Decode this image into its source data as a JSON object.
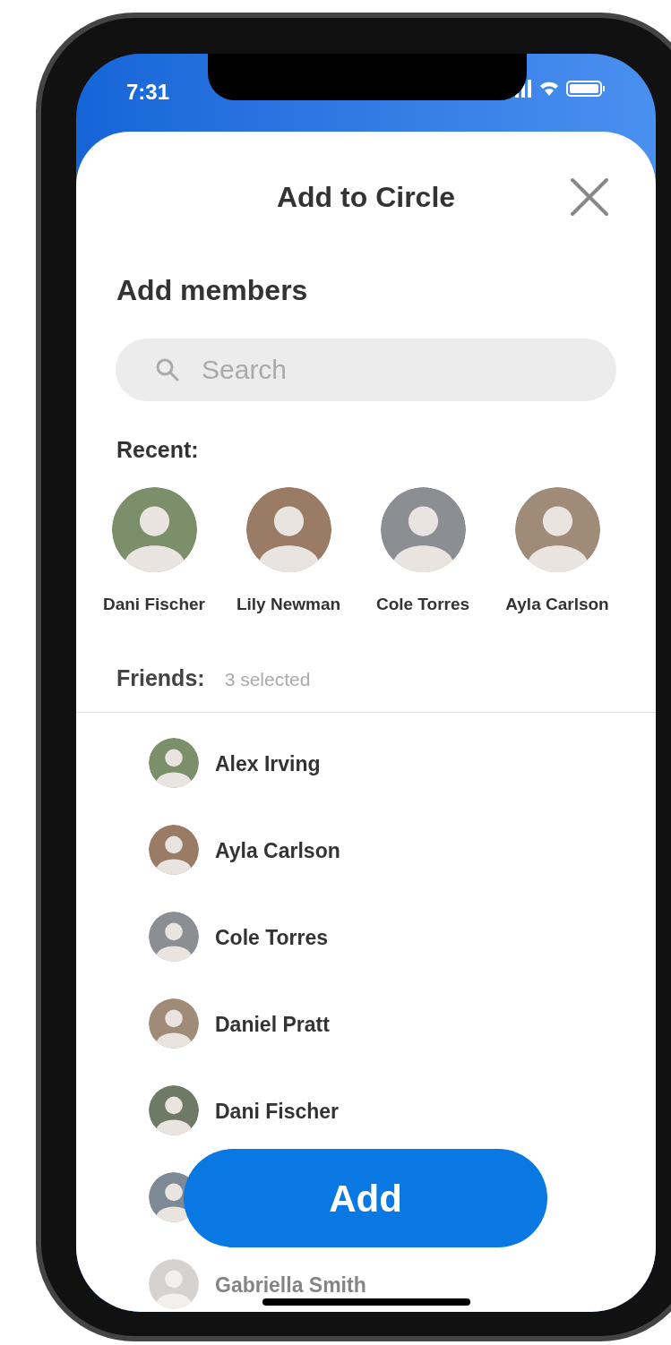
{
  "status_bar": {
    "time": "7:31"
  },
  "header": {
    "title": "Add to Circle"
  },
  "section_title": "Add members",
  "search": {
    "placeholder": "Search"
  },
  "recent": {
    "label": "Recent:",
    "people": [
      {
        "name": "Dani Fischer"
      },
      {
        "name": "Lily Newman"
      },
      {
        "name": "Cole Torres"
      },
      {
        "name": "Ayla Carlson"
      }
    ]
  },
  "friends": {
    "label": "Friends:",
    "count": "3 selected",
    "people": [
      {
        "kind": "contact",
        "name": "Alex Irving"
      },
      {
        "kind": "contact",
        "name": "Ayla Carlson"
      },
      {
        "kind": "contact",
        "name": "Cole Torres"
      },
      {
        "kind": "contact",
        "name": "Daniel Pratt"
      },
      {
        "kind": "contact",
        "name": "Dani Fischer"
      },
      {
        "kind": "covered"
      },
      {
        "kind": "contact",
        "name": "Gabriella Smith"
      }
    ]
  },
  "add_button": "Add"
}
